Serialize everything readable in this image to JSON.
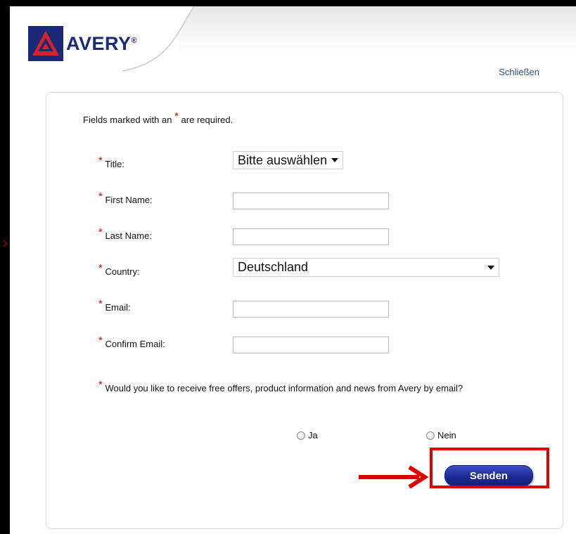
{
  "logo": {
    "text": "AVERY",
    "reg": "®",
    "icon": "avery-logo-icon"
  },
  "header": {
    "close_label": "Schließen"
  },
  "form": {
    "intro_before": "Fields marked with an",
    "intro_star": "*",
    "intro_after": "are required.",
    "star": "*",
    "title_label": "Title:",
    "title_value": "Bitte auswählen",
    "first_name_label": "First Name:",
    "first_name_value": "",
    "last_name_label": "Last Name:",
    "last_name_value": "",
    "country_label": "Country:",
    "country_value": "Deutschland",
    "email_label": "Email:",
    "email_value": "",
    "confirm_email_label": "Confirm Email:",
    "confirm_email_value": "",
    "optin_question": "Would you like to receive free offers, product information and news from Avery by email?",
    "option_yes": "Ja",
    "option_no": "Nein",
    "submit_label": "Senden"
  },
  "colors": {
    "accent_red": "#e00000",
    "brand_blue": "#1a2a78",
    "button_blue": "#1c2a95",
    "required_star": "#d40000"
  }
}
